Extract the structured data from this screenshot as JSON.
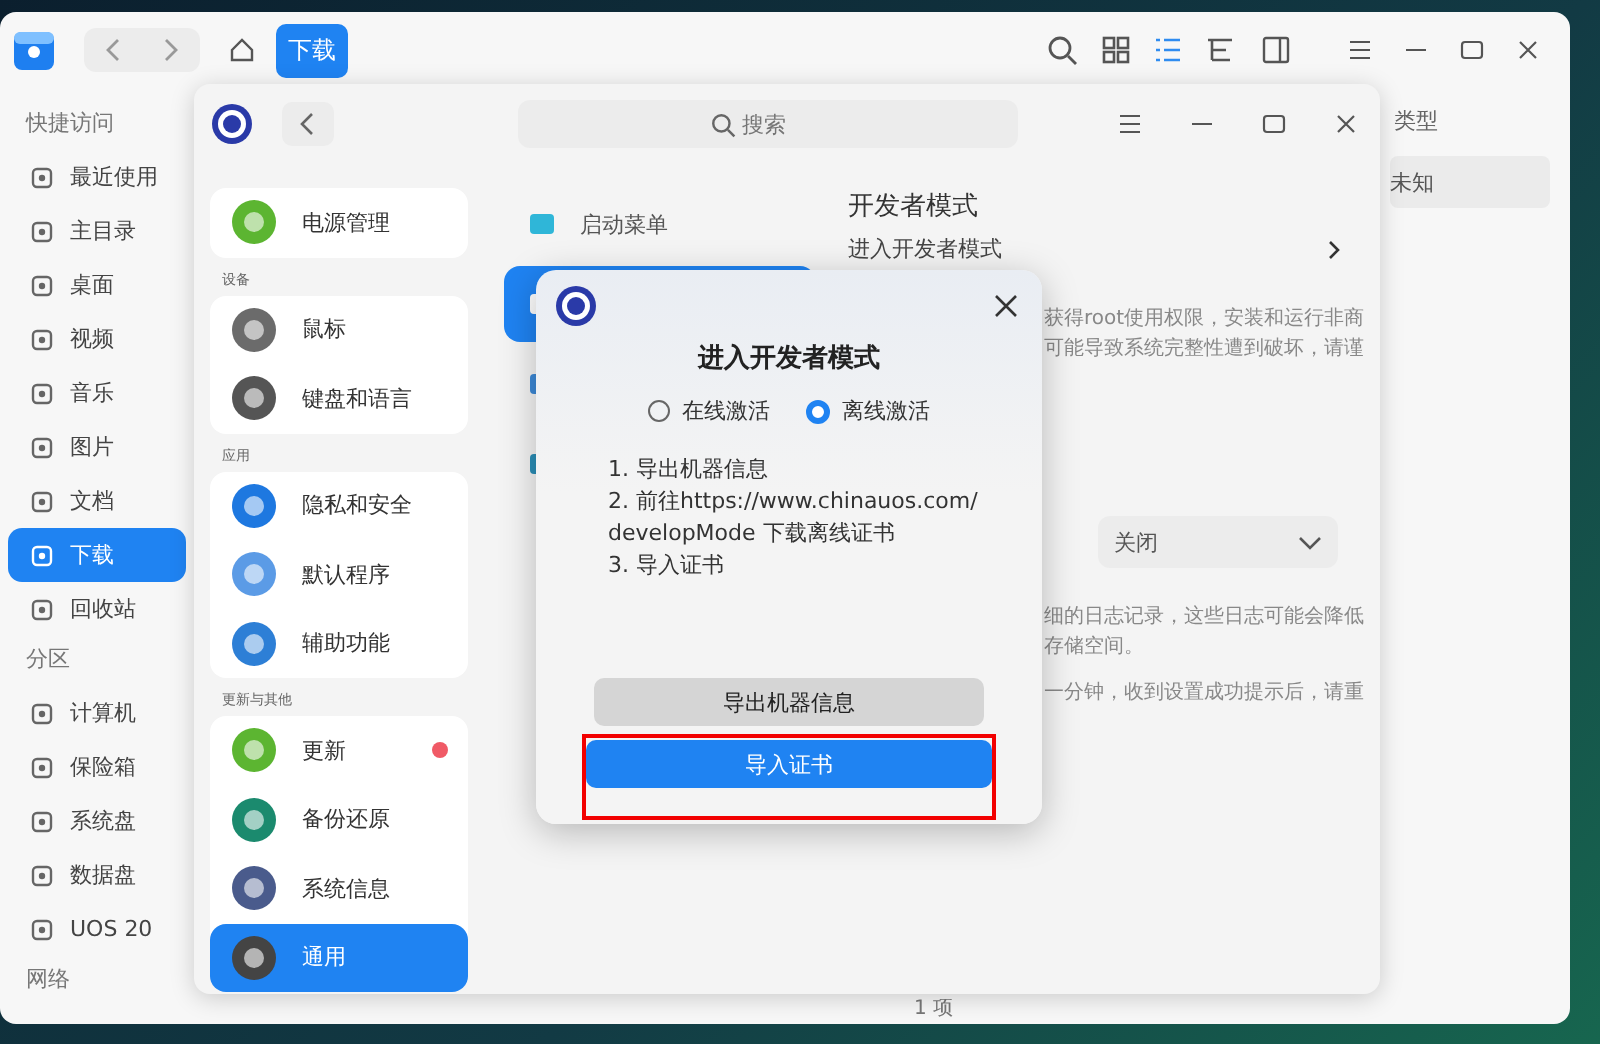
{
  "file_manager": {
    "breadcrumb": "下载",
    "view_modes": [
      {
        "kind": "icon",
        "selected": false
      },
      {
        "kind": "list",
        "selected": true
      },
      {
        "kind": "tree",
        "selected": false
      }
    ],
    "sidebar": [
      {
        "title": "快捷访问",
        "items": [
          {
            "label": "最近使用",
            "selected": false
          },
          {
            "label": "主目录",
            "selected": false
          },
          {
            "label": "桌面",
            "selected": false
          },
          {
            "label": "视频",
            "selected": false
          },
          {
            "label": "音乐",
            "selected": false
          },
          {
            "label": "图片",
            "selected": false
          },
          {
            "label": "文档",
            "selected": false
          },
          {
            "label": "下载",
            "selected": true
          },
          {
            "label": "回收站",
            "selected": false
          }
        ]
      },
      {
        "title": "分区",
        "items": [
          {
            "label": "计算机",
            "selected": false
          },
          {
            "label": "保险箱",
            "selected": false
          },
          {
            "label": "系统盘",
            "selected": false
          },
          {
            "label": "数据盘",
            "selected": false
          },
          {
            "label": "UOS 20",
            "selected": false
          }
        ]
      },
      {
        "title": "网络"
      }
    ],
    "columns": [
      "类型"
    ],
    "rows": [
      {
        "type": "未知",
        "selected": true
      }
    ],
    "status": "1 项"
  },
  "settings": {
    "search": {
      "placeholder": "搜索"
    },
    "nav": [
      {
        "items": [
          {
            "label": "电源管理",
            "selected": false,
            "badge": false
          }
        ]
      },
      {
        "title": "设备",
        "items": [
          {
            "label": "鼠标",
            "selected": false,
            "badge": false
          },
          {
            "label": "键盘和语言",
            "selected": false,
            "badge": false
          }
        ]
      },
      {
        "title": "应用",
        "items": [
          {
            "label": "隐私和安全",
            "selected": false,
            "badge": false
          },
          {
            "label": "默认程序",
            "selected": false,
            "badge": false
          },
          {
            "label": "辅助功能",
            "selected": false,
            "badge": false
          }
        ]
      },
      {
        "title": "更新与其他",
        "items": [
          {
            "label": "更新",
            "selected": false,
            "badge": true
          },
          {
            "label": "备份还原",
            "selected": false,
            "badge": false
          },
          {
            "label": "系统信息",
            "selected": false,
            "badge": false
          },
          {
            "label": "通用",
            "selected": true,
            "badge": false
          }
        ]
      }
    ],
    "subnav": [
      {
        "label": "启动菜单",
        "selected": false
      },
      {
        "selected": true
      },
      {
        "selected": false
      },
      {
        "selected": false
      }
    ],
    "panel": {
      "title": "开发者模式",
      "entry": "进入开发者模式",
      "note_lines": [
        "获得root使用权限，安装和运行非商",
        "可能导致系统完整性遭到破坏，请谨"
      ],
      "log_level": "关闭",
      "log_lines": [
        "细的日志记录，这些日志可能会降低",
        "存储空间。"
      ],
      "hint": "一分钟，收到设置成功提示后，请重"
    }
  },
  "dialog": {
    "title": "进入开发者模式",
    "options": [
      {
        "label": "在线激活",
        "selected": false
      },
      {
        "label": "离线激活",
        "selected": true
      }
    ],
    "steps": [
      "1. 导出机器信息",
      "2. 前往https://www.chinauos.com/\ndevelopMode 下载离线证书",
      "3. 导入证书"
    ],
    "buttons": [
      {
        "label": "导出机器信息",
        "kind": "secondary",
        "highlighted": false
      },
      {
        "label": "导入证书",
        "kind": "primary",
        "highlighted": true
      }
    ]
  }
}
